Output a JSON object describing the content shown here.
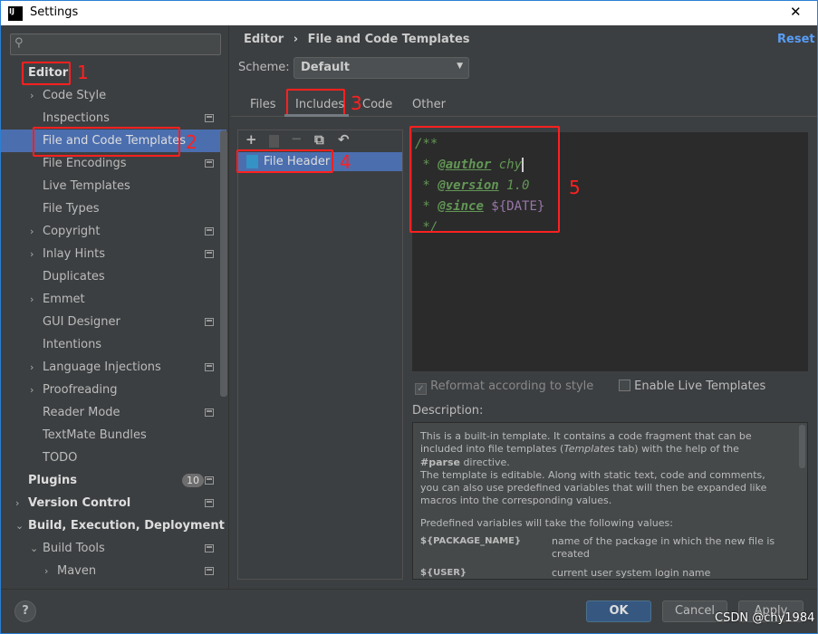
{
  "window": {
    "title": "Settings",
    "close": "✕",
    "logo": "IJ"
  },
  "sidebar": {
    "search_placeholder": "",
    "items": [
      {
        "label": "Editor",
        "level": 0,
        "bold": true
      },
      {
        "label": "Code Style",
        "level": 1,
        "arrow": "›"
      },
      {
        "label": "Inspections",
        "level": 1,
        "icon": true
      },
      {
        "label": "File and Code Templates",
        "level": 1,
        "selected": true
      },
      {
        "label": "File Encodings",
        "level": 1,
        "icon": true
      },
      {
        "label": "Live Templates",
        "level": 1
      },
      {
        "label": "File Types",
        "level": 1
      },
      {
        "label": "Copyright",
        "level": 1,
        "arrow": "›",
        "icon": true
      },
      {
        "label": "Inlay Hints",
        "level": 1,
        "arrow": "›",
        "icon": true
      },
      {
        "label": "Duplicates",
        "level": 1
      },
      {
        "label": "Emmet",
        "level": 1,
        "arrow": "›"
      },
      {
        "label": "GUI Designer",
        "level": 1,
        "icon": true
      },
      {
        "label": "Intentions",
        "level": 1
      },
      {
        "label": "Language Injections",
        "level": 1,
        "arrow": "›",
        "icon": true
      },
      {
        "label": "Proofreading",
        "level": 1,
        "arrow": "›"
      },
      {
        "label": "Reader Mode",
        "level": 1,
        "icon": true
      },
      {
        "label": "TextMate Bundles",
        "level": 1
      },
      {
        "label": "TODO",
        "level": 1
      },
      {
        "label": "Plugins",
        "level": 0,
        "bold": true,
        "badge": "10",
        "icon": true
      },
      {
        "label": "Version Control",
        "level": 0,
        "bold": true,
        "arrow": "›",
        "icon": true
      },
      {
        "label": "Build, Execution, Deployment",
        "level": 0,
        "bold": true,
        "arrow": "⌄"
      },
      {
        "label": "Build Tools",
        "level": 1,
        "arrow": "⌄",
        "icon": true
      },
      {
        "label": "Maven",
        "level": 2,
        "arrow": "›",
        "icon": true
      }
    ]
  },
  "breadcrumb": {
    "parent": "Editor",
    "sep": "›",
    "current": "File and Code Templates"
  },
  "reset": "Reset",
  "scheme": {
    "label": "Scheme:",
    "value": "Default"
  },
  "tabs": [
    "Files",
    "Includes",
    "Code",
    "Other"
  ],
  "active_tab": 1,
  "toolbar": {
    "add": "+",
    "copy_icon": "",
    "remove": "−",
    "duplicate": "⧉",
    "revert": "↶"
  },
  "templates": [
    {
      "name": "File Header"
    }
  ],
  "code": {
    "l1": "/**",
    "star": " * ",
    "author_tag": "@author",
    "author_val": " chy",
    "version_tag": "@version",
    "version_val": " 1.0",
    "since_tag": "@since",
    "since_val": " ${DATE}",
    "l5": " */"
  },
  "options": {
    "reformat": "Reformat according to style",
    "reformat_checked": true,
    "live": "Enable Live Templates",
    "live_checked": false
  },
  "description": {
    "label": "Description:",
    "p1a": "This is a built-in template. It contains a code fragment that can be included into file templates (",
    "p1b": "Templates",
    "p1c": " tab) with the help of the ",
    "p1d": "#parse",
    "p1e": " directive.",
    "p2": "The template is editable. Along with static text, code and comments, you can also use predefined variables that will then be expanded like macros into the corresponding values.",
    "p3": "Predefined variables will take the following values:",
    "vars": [
      {
        "name": "${PACKAGE_NAME}",
        "desc": "name of the package in which the new file is created"
      },
      {
        "name": "${USER}",
        "desc": "current user system login name"
      }
    ]
  },
  "buttons": {
    "help": "?",
    "ok": "OK",
    "cancel": "Cancel",
    "apply": "Apply"
  },
  "annotations": [
    "1",
    "2",
    "3",
    "4",
    "5"
  ],
  "watermark": "CSDN @chy1984",
  "colors": {
    "bg": "#3c3f41",
    "selection": "#4b6eaf",
    "editor": "#2b2b2b",
    "annotation": "#ff2020"
  }
}
